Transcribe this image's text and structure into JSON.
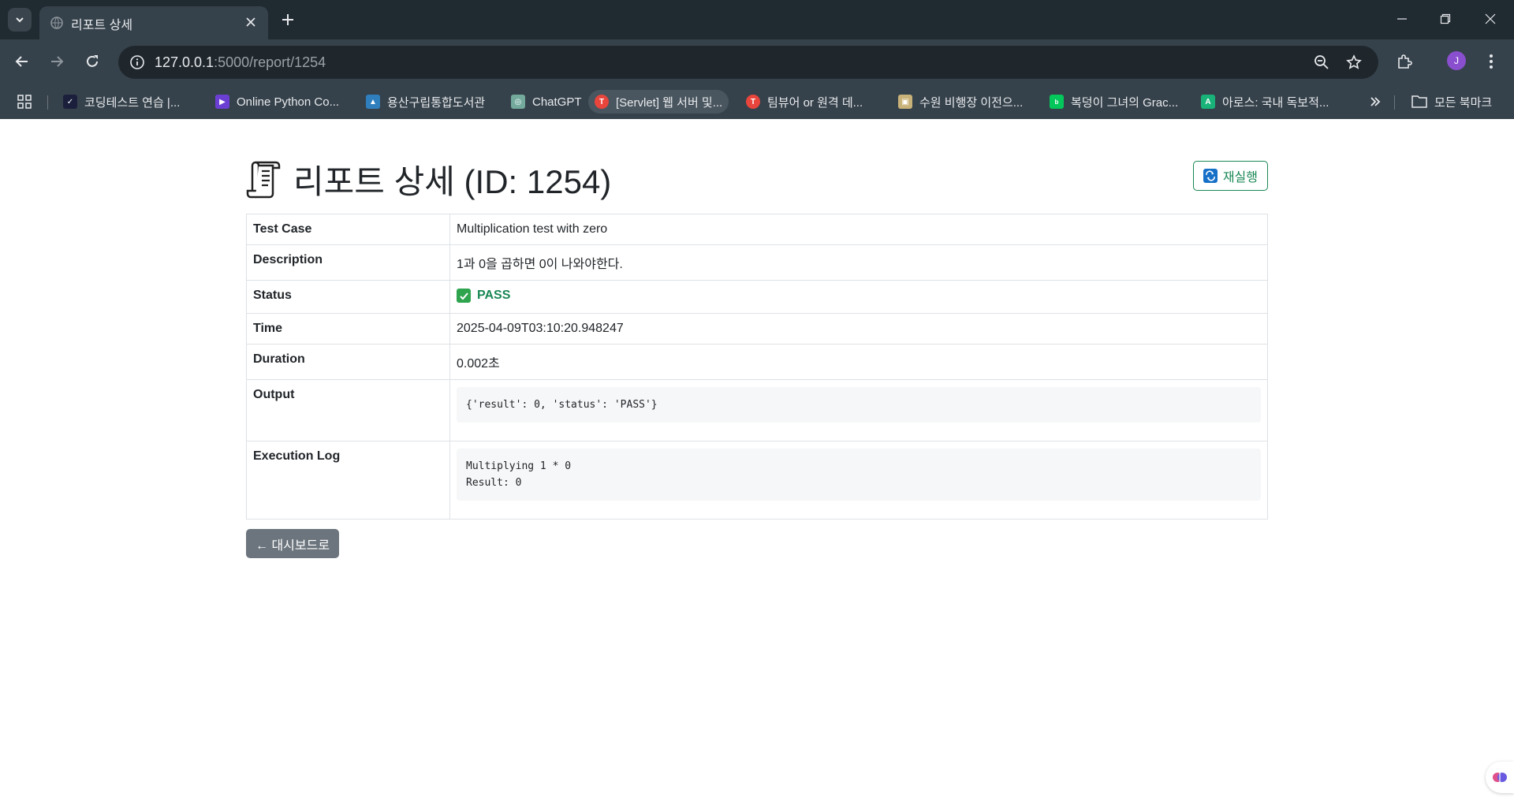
{
  "browser": {
    "tab": {
      "title": "리포트 상세"
    },
    "url": {
      "host": "127.0.0.1",
      "rest": ":5000/report/1254"
    },
    "profile_initial": "J",
    "bookmarks": [
      {
        "label": "코딩테스트 연습 |...",
        "color": "#1b1f3b",
        "glyph": "✓"
      },
      {
        "label": "Online Python Co...",
        "color": "#6b3fd4",
        "glyph": "▶"
      },
      {
        "label": "용산구립통합도서관",
        "color": "#2f7fbf",
        "glyph": "▲"
      },
      {
        "label": "ChatGPT",
        "color": "#74aa9c",
        "glyph": "◎"
      },
      {
        "label": "[Servlet] 웹 서버 및...",
        "color": "#e8453c",
        "glyph": "T"
      },
      {
        "label": "팀뷰어 or 원격 데...",
        "color": "#e8453c",
        "glyph": "T"
      },
      {
        "label": "수원 비행장 이전으...",
        "color": "#c9b27a",
        "glyph": "▣"
      },
      {
        "label": "복덩이 그녀의 Grac...",
        "color": "#03c75a",
        "glyph": "b"
      },
      {
        "label": "아로스: 국내 독보적...",
        "color": "#19b37a",
        "glyph": "A"
      }
    ],
    "all_bookmarks_label": "모든 북마크"
  },
  "page": {
    "title": "리포트 상세 (ID: 1254)",
    "rerun_label": "재실행",
    "back_label": "← 대시보드로"
  },
  "report": {
    "rows": {
      "test_case": {
        "key": "Test Case",
        "value": "Multiplication test with zero"
      },
      "description": {
        "key": "Description",
        "value": "1과 0을 곱하면 0이 나와야한다."
      },
      "status": {
        "key": "Status",
        "value": "PASS"
      },
      "time": {
        "key": "Time",
        "value": "2025-04-09T03:10:20.948247"
      },
      "duration": {
        "key": "Duration",
        "value": "0.002초"
      },
      "output": {
        "key": "Output",
        "value": "{'result': 0, 'status': 'PASS'}"
      },
      "execution_log": {
        "key": "Execution Log",
        "value": "Multiplying 1 * 0\nResult: 0"
      }
    }
  },
  "colors": {
    "pass": "#198754",
    "rerun_border": "#198754",
    "back_button": "#6c757d",
    "chrome_dark": "#202a31",
    "chrome_toolbar": "#36424b"
  }
}
